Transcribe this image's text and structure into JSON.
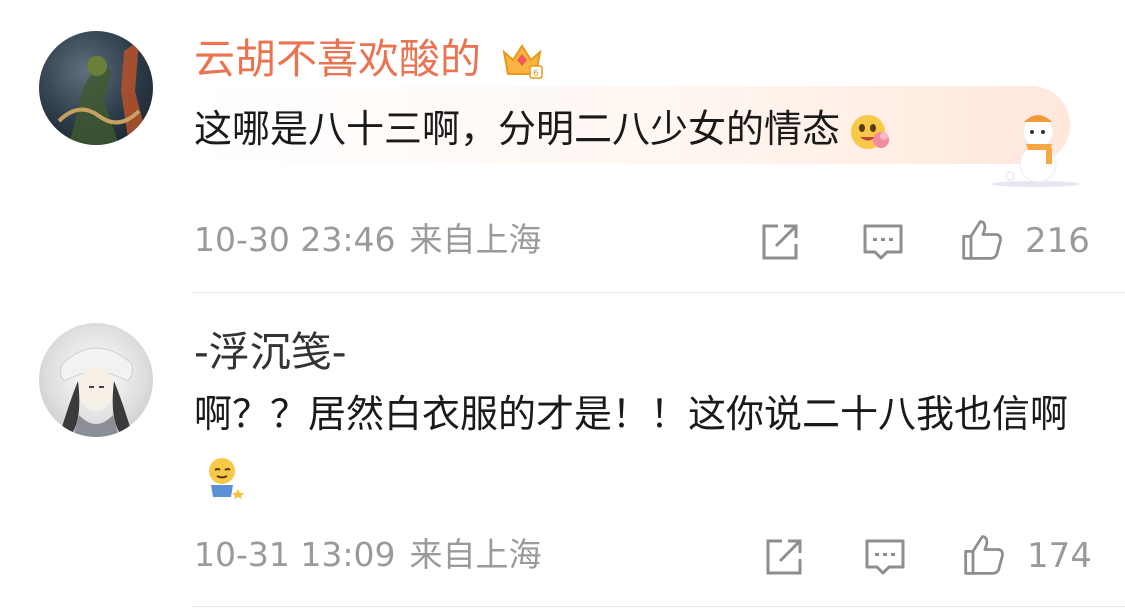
{
  "comments": [
    {
      "username": "云胡不喜欢酸的",
      "text": "这哪是八十三啊，分明二八少女的情态",
      "time": "10-30 23:46",
      "location": "来自上海",
      "likes": "216"
    },
    {
      "username": "-浮沉笺-",
      "text": "啊？？居然白衣服的才是！！这你说二十八我也信啊",
      "time": "10-31 13:09",
      "location": "来自上海",
      "likes": "174"
    }
  ],
  "colors": {
    "vip_username": "#eb7350",
    "username": "#333333",
    "meta": "#9a9a9a",
    "divider": "#e6e6e6"
  },
  "icons": [
    "crown-icon",
    "repost-icon",
    "comment-icon",
    "like-icon",
    "emoji-icon",
    "snowman-icon"
  ]
}
